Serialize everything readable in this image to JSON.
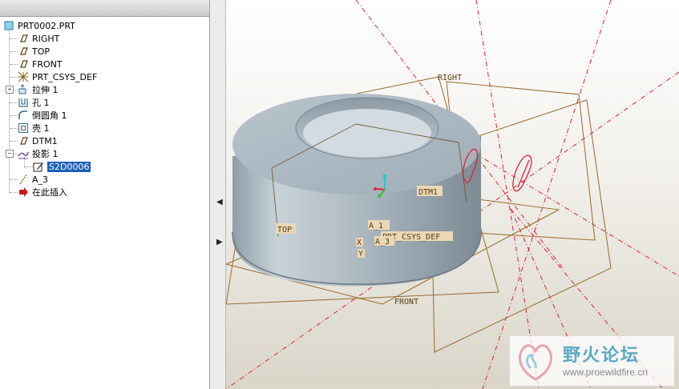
{
  "model_tree": {
    "root": "PRT0002.PRT",
    "items": [
      {
        "label": "RIGHT",
        "icon": "datum-plane-icon"
      },
      {
        "label": "TOP",
        "icon": "datum-plane-icon"
      },
      {
        "label": "FRONT",
        "icon": "datum-plane-icon"
      },
      {
        "label": "PRT_CSYS_DEF",
        "icon": "coordinate-system-icon"
      },
      {
        "label": "拉伸 1",
        "icon": "extrude-icon"
      },
      {
        "label": "孔 1",
        "icon": "hole-icon"
      },
      {
        "label": "倒圆角 1",
        "icon": "round-icon"
      },
      {
        "label": "壳 1",
        "icon": "shell-icon"
      },
      {
        "label": "DTM1",
        "icon": "datum-plane-icon"
      },
      {
        "label": "投影 1",
        "icon": "projection-icon"
      },
      {
        "label": "S2D0006",
        "icon": "sketch-icon"
      },
      {
        "label": "A_3",
        "icon": "datum-axis-icon"
      },
      {
        "label": "在此插入",
        "icon": "insert-here-arrow-icon"
      }
    ],
    "selected": "S2D0006"
  },
  "splitter": {
    "collapse_glyph": "◀",
    "expand_glyph": "▶"
  },
  "viewport": {
    "plane_tags": {
      "right": "RIGHT",
      "top": "TOP",
      "front": "FRONT",
      "dtm1": "DTM1",
      "csys": "PRT_CSYS_DEF",
      "axis_a1": "A_1",
      "axis_a3": "A_3",
      "axis_x": "X",
      "axis_y": "Y"
    },
    "colors": {
      "datum_plane": "#9a6a2a",
      "datum_axis": "#e0203a",
      "solid": "#a9b6c0",
      "projected_curve": "#e0203a"
    }
  },
  "watermark": {
    "title": "野火论坛",
    "url": "www.proewildfire.cn"
  }
}
